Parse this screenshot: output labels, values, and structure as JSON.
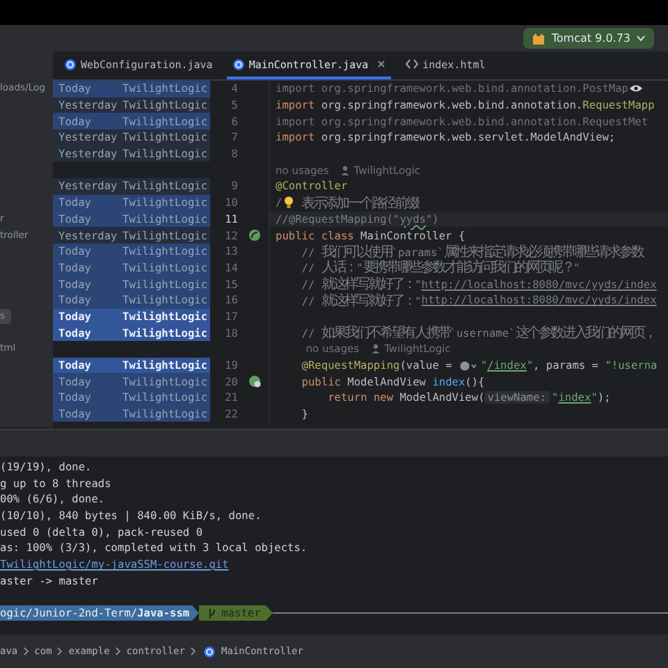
{
  "toolbar": {
    "run_config": "Tomcat 9.0.73"
  },
  "tabs": [
    {
      "label": "WebConfiguration.java",
      "kind": "java",
      "selected": false
    },
    {
      "label": "MainController.java",
      "kind": "java",
      "selected": true
    },
    {
      "label": "index.html",
      "kind": "html",
      "selected": false
    }
  ],
  "project_tree": {
    "items": [
      {
        "label": "loads/Log",
        "selected": false
      },
      {
        "label": "r",
        "selected": false
      },
      {
        "label": "troller",
        "selected": false
      },
      {
        "label": "s",
        "selected": true
      },
      {
        "label": "tml",
        "selected": false
      }
    ]
  },
  "editor": {
    "rows": [
      {
        "kind": "code",
        "number": "4",
        "blame": {
          "date": "Today",
          "author": "TwilightLogic",
          "highlighted": false
        },
        "tokens": [
          {
            "kind": "dim",
            "text": "import org.springframework.web.bind.annotation.PostMap"
          },
          {
            "kind": "eye"
          }
        ]
      },
      {
        "kind": "code",
        "number": "5",
        "blame": {
          "date": "Yesterday",
          "author": "TwilightLogic",
          "highlighted": false
        },
        "tokens": [
          {
            "kind": "kw",
            "text": "import"
          },
          {
            "kind": "plain",
            "text": " org.springframework.web.bind.annotation."
          },
          {
            "kind": "annot",
            "text": "RequestMapp"
          }
        ]
      },
      {
        "kind": "code",
        "number": "6",
        "blame": {
          "date": "Today",
          "author": "TwilightLogic",
          "highlighted": false
        },
        "tokens": [
          {
            "kind": "dim",
            "text": "import org.springframework.web.bind.annotation.RequestMet"
          }
        ]
      },
      {
        "kind": "code",
        "number": "7",
        "blame": {
          "date": "Yesterday",
          "author": "TwilightLogic",
          "highlighted": false
        },
        "tokens": [
          {
            "kind": "kw",
            "text": "import"
          },
          {
            "kind": "plain",
            "text": " org.springframework.web.servlet.ModelAndView;"
          }
        ]
      },
      {
        "kind": "code",
        "number": "8",
        "blame": {
          "date": "Yesterday",
          "author": "TwilightLogic",
          "highlighted": false
        },
        "tokens": []
      },
      {
        "kind": "inlay",
        "tokens": [
          {
            "kind": "usages",
            "text": "no usages"
          },
          {
            "kind": "author",
            "text": "TwilightLogic"
          }
        ]
      },
      {
        "kind": "code",
        "number": "9",
        "blame": {
          "date": "Yesterday",
          "author": "TwilightLogic",
          "highlighted": false
        },
        "tokens": [
          {
            "kind": "annot",
            "text": "@Controller"
          }
        ]
      },
      {
        "kind": "code",
        "number": "10",
        "blame": {
          "date": "Today",
          "author": "TwilightLogic",
          "highlighted": false
        },
        "tokens": [
          {
            "kind": "comment",
            "text": "/"
          },
          {
            "kind": "bulb"
          },
          {
            "kind": "comment",
            "text": " 表示添加一个路径前缀"
          }
        ]
      },
      {
        "kind": "code",
        "number": "11",
        "current": true,
        "blame": {
          "date": "Today",
          "author": "TwilightLogic",
          "highlighted": false
        },
        "tokens": [
          {
            "kind": "comment",
            "text": "//@RequestMapping(\""
          },
          {
            "kind": "typo",
            "text": "yyds"
          },
          {
            "kind": "comment",
            "text": "\")"
          }
        ]
      },
      {
        "kind": "code",
        "number": "12",
        "gutter": {
          "kind": "bean"
        },
        "blame": {
          "date": "Yesterday",
          "author": "TwilightLogic",
          "highlighted": false
        },
        "tokens": [
          {
            "kind": "kw",
            "text": "public class "
          },
          {
            "kind": "plain",
            "text": "MainController {"
          }
        ]
      },
      {
        "kind": "code",
        "number": "13",
        "blame": {
          "date": "Today",
          "author": "TwilightLogic",
          "highlighted": false
        },
        "tokens": [
          {
            "kind": "indent"
          },
          {
            "kind": "comment",
            "text": "// 我们可以使用`params`属性来指定请求必须携带哪些请求参数"
          }
        ]
      },
      {
        "kind": "code",
        "number": "14",
        "blame": {
          "date": "Today",
          "author": "TwilightLogic",
          "highlighted": false
        },
        "tokens": [
          {
            "kind": "indent"
          },
          {
            "kind": "comment",
            "text": "// 人话：\"要携带哪些参数才能访问我们的网页呢？\""
          }
        ]
      },
      {
        "kind": "code",
        "number": "15",
        "blame": {
          "date": "Today",
          "author": "TwilightLogic",
          "highlighted": false
        },
        "tokens": [
          {
            "kind": "indent"
          },
          {
            "kind": "comment",
            "text": "// 就这样写就好了：\""
          },
          {
            "kind": "link",
            "text": "http://localhost:8080/mvc/yyds/index"
          }
        ]
      },
      {
        "kind": "code",
        "number": "16",
        "blame": {
          "date": "Today",
          "author": "TwilightLogic",
          "highlighted": false
        },
        "tokens": [
          {
            "kind": "indent"
          },
          {
            "kind": "comment",
            "text": "// 就这样写就好了：\""
          },
          {
            "kind": "link",
            "text": "http://localhost:8080/mvc/yyds/index"
          }
        ]
      },
      {
        "kind": "code",
        "number": "17",
        "blame": {
          "date": "Today",
          "author": "TwilightLogic",
          "highlighted": true
        },
        "tokens": []
      },
      {
        "kind": "code",
        "number": "18",
        "blame": {
          "date": "Today",
          "author": "TwilightLogic",
          "highlighted": true
        },
        "tokens": [
          {
            "kind": "indent"
          },
          {
            "kind": "comment",
            "text": "// 如果我们不希望有人携带`username`这个参数进入我们的网页，"
          }
        ]
      },
      {
        "kind": "inlay",
        "tokens": [
          {
            "kind": "indent"
          },
          {
            "kind": "usages",
            "text": "no usages"
          },
          {
            "kind": "author",
            "text": "TwilightLogic"
          }
        ]
      },
      {
        "kind": "code",
        "number": "19",
        "blame": {
          "date": "Today",
          "author": "TwilightLogic",
          "highlighted": true
        },
        "tokens": [
          {
            "kind": "indent"
          },
          {
            "kind": "annot",
            "text": "@RequestMapping"
          },
          {
            "kind": "plain",
            "text": "(value = "
          },
          {
            "kind": "globe"
          },
          {
            "kind": "str",
            "text": "\""
          },
          {
            "kind": "strlink",
            "text": "/index"
          },
          {
            "kind": "str",
            "text": "\""
          },
          {
            "kind": "plain",
            "text": ", params = "
          },
          {
            "kind": "str",
            "text": "\"!userna"
          }
        ]
      },
      {
        "kind": "code",
        "number": "20",
        "gutter": {
          "kind": "bean-web"
        },
        "blame": {
          "date": "Today",
          "author": "TwilightLogic",
          "highlighted": false
        },
        "tokens": [
          {
            "kind": "indent"
          },
          {
            "kind": "kw",
            "text": "public "
          },
          {
            "kind": "plain",
            "text": "ModelAndView "
          },
          {
            "kind": "method",
            "text": "index"
          },
          {
            "kind": "plain",
            "text": "(){"
          }
        ]
      },
      {
        "kind": "code",
        "number": "21",
        "blame": {
          "date": "Today",
          "author": "TwilightLogic",
          "highlighted": false
        },
        "tokens": [
          {
            "kind": "indent"
          },
          {
            "kind": "indent"
          },
          {
            "kind": "kw",
            "text": "return new "
          },
          {
            "kind": "plain",
            "text": "ModelAndView("
          },
          {
            "kind": "hint",
            "text": "viewName:"
          },
          {
            "kind": "str",
            "text": "\""
          },
          {
            "kind": "strlink",
            "text": "index"
          },
          {
            "kind": "str",
            "text": "\""
          },
          {
            "kind": "plain",
            "text": ");"
          }
        ]
      },
      {
        "kind": "code",
        "number": "22",
        "blame": {
          "date": "Today",
          "author": "TwilightLogic",
          "highlighted": false
        },
        "tokens": [
          {
            "kind": "indent"
          },
          {
            "kind": "plain",
            "text": "}"
          }
        ]
      }
    ]
  },
  "terminal": {
    "lines": [
      {
        "kind": "text",
        "text": "(19/19), done."
      },
      {
        "kind": "text",
        "text": "g up to 8 threads"
      },
      {
        "kind": "text",
        "text": "00% (6/6), done."
      },
      {
        "kind": "text",
        "text": "(10/10), 840 bytes | 840.00 KiB/s, done."
      },
      {
        "kind": "text",
        "text": "used 0 (delta 0), pack-reused 0"
      },
      {
        "kind": "text",
        "text": "as: 100% (3/3), completed with 3 local objects."
      },
      {
        "kind": "link",
        "text": "TwilightLogic/my-javaSSM-course.git"
      },
      {
        "kind": "text",
        "text": "aster -> master"
      }
    ],
    "prompt": {
      "path": "ogic/Junior-2nd-Term/**Java-ssm**",
      "branch": "master"
    }
  },
  "breadcrumbs": [
    {
      "label": "ava",
      "kind": "folder"
    },
    {
      "label": "com",
      "kind": "folder"
    },
    {
      "label": "example",
      "kind": "folder"
    },
    {
      "label": "controller",
      "kind": "folder"
    },
    {
      "label": "MainController",
      "kind": "class"
    }
  ]
}
